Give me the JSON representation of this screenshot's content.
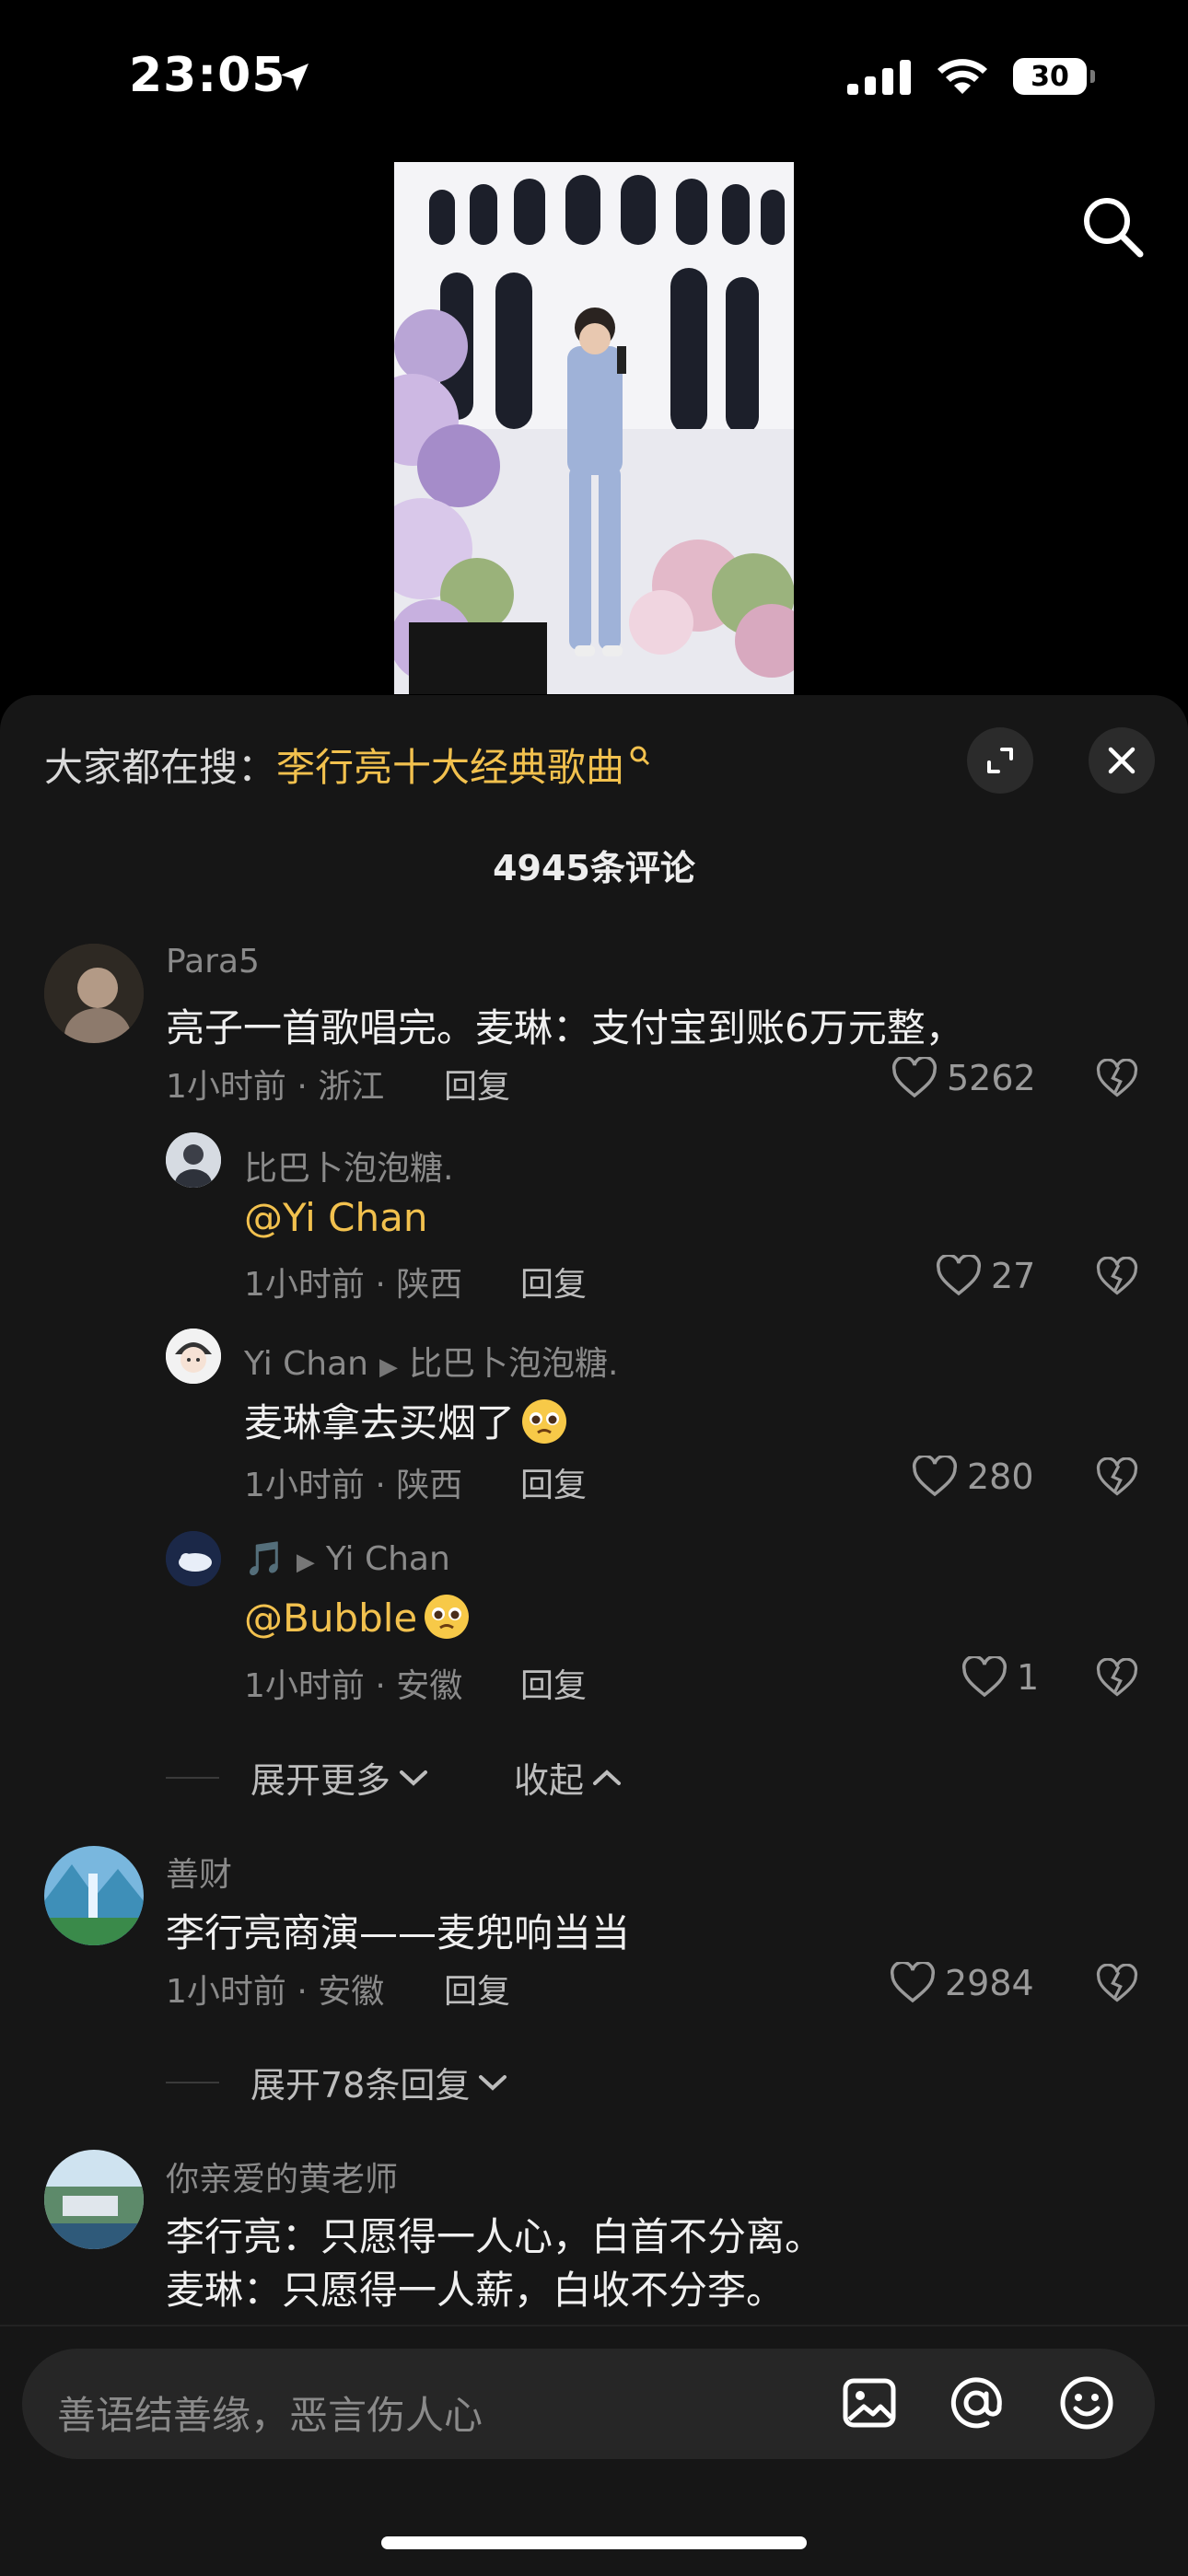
{
  "status": {
    "time": "23:05",
    "battery": "30"
  },
  "hot_search": {
    "label": "大家都在搜：",
    "keyword": "李行亮十大经典歌曲"
  },
  "comments_title": "4945条评论",
  "comments": [
    {
      "user": "Para5",
      "text": "亮子一首歌唱完。麦琳：支付宝到账6万元整，",
      "time": "1小时前 · 浙江",
      "reply": "回复",
      "likes": "5262"
    },
    {
      "user": "比巴卜泡泡糖.",
      "mention": "@Yi Chan",
      "time": "1小时前 · 陕西",
      "reply": "回复",
      "likes": "27"
    },
    {
      "user": "Yi Chan",
      "reply_to": "比巴卜泡泡糖.",
      "text": "麦琳拿去买烟了",
      "time": "1小时前 · 陕西",
      "reply": "回复",
      "likes": "280"
    },
    {
      "user": "🎵",
      "reply_to": "Yi Chan",
      "mention": "@Bubble",
      "time": "1小时前 · 安徽",
      "reply": "回复",
      "likes": "1"
    },
    {
      "user": "善财",
      "text": "李行亮商演——麦兜响当当",
      "time": "1小时前 · 安徽",
      "reply": "回复",
      "likes": "2984"
    },
    {
      "user": "你亲爱的黄老师",
      "text_line1": "李行亮：只愿得一人心，白首不分离。",
      "text_line2": "麦琳：只愿得一人薪，白收不分李。"
    }
  ],
  "expand_more": "展开更多",
  "collapse": "收起",
  "expand_replies": "展开78条回复",
  "input_placeholder": "善语结善缘，恶言伤人心",
  "colors": {
    "accent": "#f2c14e",
    "sheet_bg": "#161616"
  }
}
